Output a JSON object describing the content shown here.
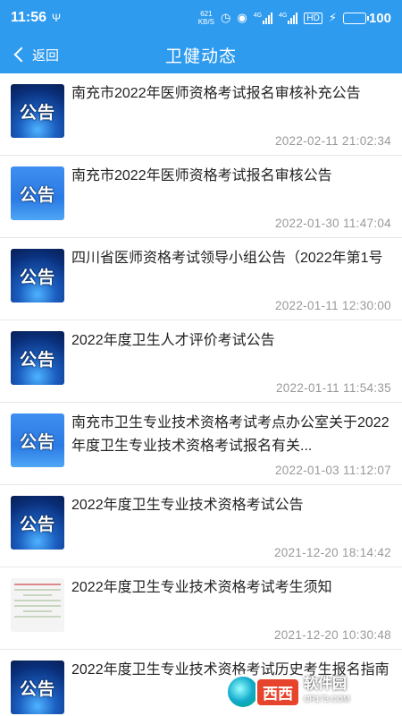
{
  "status_bar": {
    "time": "11:56",
    "usb_icon": "Ψ",
    "net_speed_value": "621",
    "net_speed_unit": "KB/S",
    "network_type_1": "4G",
    "network_type_2": "4G",
    "hd_label": "HD",
    "battery_level": "100"
  },
  "header": {
    "back_label": "返回",
    "title": "卫健动态"
  },
  "news": [
    {
      "title": "南充市2022年医师资格考试报名审核补充公告",
      "date": "2022-02-11 21:02:34",
      "thumb": "公告",
      "thumb_style": "dark"
    },
    {
      "title": "南充市2022年医师资格考试报名审核公告",
      "date": "2022-01-30 11:47:04",
      "thumb": "公告",
      "thumb_style": "bright"
    },
    {
      "title": "四川省医师资格考试领导小组公告（2022年第1号",
      "date": "2022-01-11 12:30:00",
      "thumb": "公告",
      "thumb_style": "dark"
    },
    {
      "title": "2022年度卫生人才评价考试公告",
      "date": "2022-01-11 11:54:35",
      "thumb": "公告",
      "thumb_style": "dark"
    },
    {
      "title": "南充市卫生专业技术资格考试考点办公室关于2022年度卫生专业技术资格考试报名有关...",
      "date": "2022-01-03 11:12:07",
      "thumb": "公告",
      "thumb_style": "bright"
    },
    {
      "title": "2022年度卫生专业技术资格考试公告",
      "date": "2021-12-20 18:14:42",
      "thumb": "公告",
      "thumb_style": "dark"
    },
    {
      "title": "2022年度卫生专业技术资格考试考生须知",
      "date": "2021-12-20 10:30:48",
      "thumb": "",
      "thumb_style": "doc"
    },
    {
      "title": "2022年度卫生专业技术资格考试历史考生报名指南",
      "date": "",
      "thumb": "公告",
      "thumb_style": "dark"
    }
  ],
  "watermark": {
    "brand": "西西",
    "site": "软件园",
    "url": "CR173.COM"
  },
  "colors": {
    "header_bg": "#2e9bef",
    "date_text": "#999999",
    "battery_fill": "#4cd964"
  }
}
